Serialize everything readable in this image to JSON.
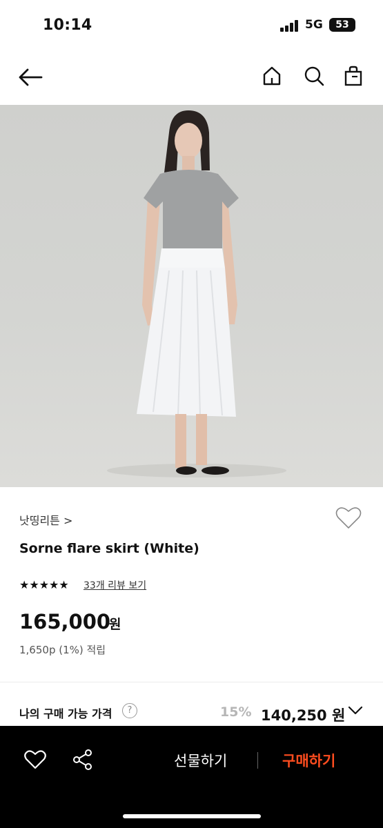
{
  "status_bar": {
    "time": "10:14",
    "network": "5G",
    "battery": "53"
  },
  "header": {
    "back_icon": "arrow-left-icon",
    "home_icon": "home-icon",
    "search_icon": "search-icon",
    "bag_icon": "shopping-bag-icon"
  },
  "product": {
    "image_alt": "product-photo",
    "brand": "낫띵리튼 >",
    "name": "Sorne flare skirt (White)",
    "stars": "★★★★★",
    "rating": 5,
    "reviews_label": "33개 리뷰 보기",
    "price": "165,000",
    "currency": "원",
    "points": "1,650p (1%) 적립"
  },
  "my_price": {
    "label": "나의 구매 가능 가격",
    "help": "?",
    "discount": "15%",
    "price": "140,250 원"
  },
  "bottom_bar": {
    "gift_label": "선물하기",
    "buy_label": "구매하기"
  },
  "colors": {
    "accent": "#ff4d1f",
    "bar": "#000000",
    "muted": "#b6b6b6"
  }
}
